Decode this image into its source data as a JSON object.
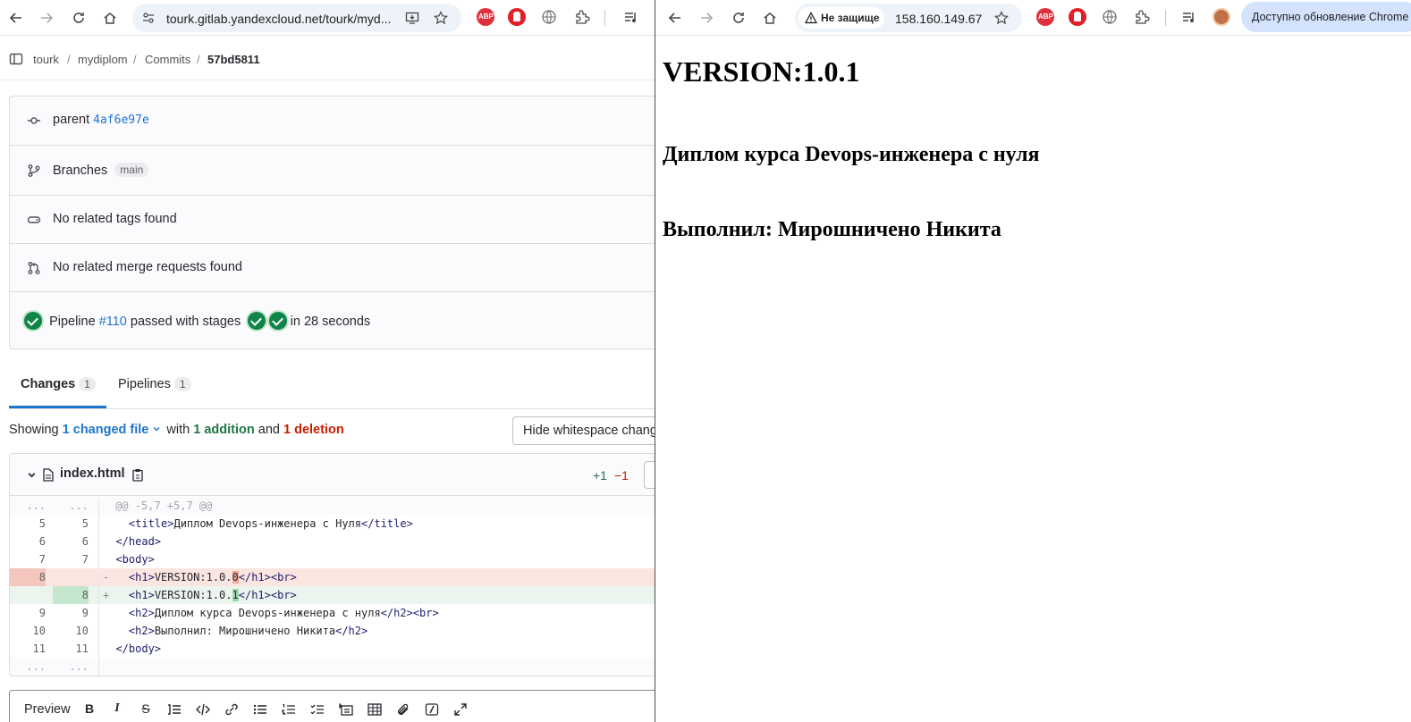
{
  "left_browser": {
    "url": "tourk.gitlab.yandexcloud.net/tourk/myd..."
  },
  "breadcrumb": {
    "items": [
      "tourk",
      "mydiplom",
      "Commits",
      "57bd5811"
    ]
  },
  "commit_info": {
    "parent_label": "parent",
    "parent_sha": "4af6e97e",
    "branches_label": "Branches",
    "branch_name": "main",
    "tags_text": "No related tags found",
    "merge_text": "No related merge requests found",
    "pipeline_prefix": "Pipeline",
    "pipeline_id": "#110",
    "pipeline_status": "passed with stages",
    "pipeline_duration": "in 28 seconds"
  },
  "tabs": [
    {
      "label": "Changes",
      "count": "1"
    },
    {
      "label": "Pipelines",
      "count": "1"
    }
  ],
  "summary": {
    "showing": "Showing",
    "changed": "1 changed file",
    "with": "with",
    "additions": "1 addition",
    "and": "and",
    "deletions": "1 deletion",
    "whitespace_button": "Hide whitespace changes"
  },
  "file": {
    "name": "index.html",
    "added": "+1",
    "removed": "−1"
  },
  "diff": {
    "hunk_old": "...",
    "hunk_new": "...",
    "hunk_header": "@@ -5,7 +5,7 @@",
    "lines": [
      {
        "old": "5",
        "new": "5",
        "sign": " ",
        "type": "ctx",
        "pre": "  ",
        "open": "<title>",
        "text": "Диплом Devops-инженера с Нуля",
        "close": "</title>",
        "tail": ""
      },
      {
        "old": "6",
        "new": "6",
        "sign": " ",
        "type": "ctx",
        "pre": "",
        "open": "</head>",
        "text": "",
        "close": "",
        "tail": ""
      },
      {
        "old": "7",
        "new": "7",
        "sign": " ",
        "type": "ctx",
        "pre": "",
        "open": "<body>",
        "text": "",
        "close": "",
        "tail": ""
      },
      {
        "old": "8",
        "new": "",
        "sign": "-",
        "type": "del",
        "pre": "  ",
        "open": "<h1>",
        "text": "VERSION:1.0.",
        "hl": "0",
        "close": "</h1>",
        "tail": "<br>"
      },
      {
        "old": "",
        "new": "8",
        "sign": "+",
        "type": "add",
        "pre": "  ",
        "open": "<h1>",
        "text": "VERSION:1.0.",
        "hl": "1",
        "close": "</h1>",
        "tail": "<br>"
      },
      {
        "old": "9",
        "new": "9",
        "sign": " ",
        "type": "ctx",
        "pre": "  ",
        "open": "<h2>",
        "text": "Диплом курса Devops-инженера с нуля",
        "close": "</h2>",
        "tail": "<br>"
      },
      {
        "old": "10",
        "new": "10",
        "sign": " ",
        "type": "ctx",
        "pre": "  ",
        "open": "<h2>",
        "text": "Выполнил: Мирошничено Никита",
        "close": "</h2>",
        "tail": ""
      },
      {
        "old": "11",
        "new": "11",
        "sign": " ",
        "type": "ctx",
        "pre": "",
        "open": "</body>",
        "text": "",
        "close": "",
        "tail": ""
      }
    ],
    "footer_old": "...",
    "footer_new": "..."
  },
  "editor": {
    "preview_label": "Preview",
    "bold": "B",
    "italic": "I",
    "strike": "S"
  },
  "right_browser": {
    "security_label": "Не защище",
    "url": "158.160.149.67",
    "update_label": "Доступно обновление Chrome"
  },
  "page": {
    "h1": "VERSION:1.0.1",
    "h2_course": "Диплом курса Devops-инженера с нуля",
    "h2_author": "Выполнил: Мирошничено Никита"
  },
  "colors": {
    "link": "#1f75cb",
    "success": "#108548",
    "addition": "#217645",
    "deletion": "#c91c00"
  }
}
